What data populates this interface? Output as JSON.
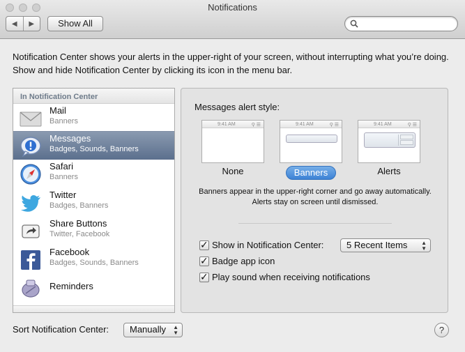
{
  "window": {
    "title": "Notifications",
    "nav_back": "◀",
    "nav_forward": "▶",
    "show_all_label": "Show All",
    "search_placeholder": ""
  },
  "description": "Notification Center shows your alerts in the upper-right of your screen, without interrupting what you’re doing. Show and hide Notification Center by clicking its icon in the menu bar.",
  "sidebar": {
    "header": "In Notification Center",
    "selected_index": 1,
    "items": [
      {
        "name": "Mail",
        "sub": "Banners",
        "icon": "mail-icon"
      },
      {
        "name": "Messages",
        "sub": "Badges, Sounds, Banners",
        "icon": "messages-icon"
      },
      {
        "name": "Safari",
        "sub": "Banners",
        "icon": "safari-icon"
      },
      {
        "name": "Twitter",
        "sub": "Badges, Banners",
        "icon": "twitter-icon"
      },
      {
        "name": "Share Buttons",
        "sub": "Twitter, Facebook",
        "icon": "share-icon"
      },
      {
        "name": "Facebook",
        "sub": "Badges, Sounds, Banners",
        "icon": "facebook-icon"
      },
      {
        "name": "Reminders",
        "sub": "",
        "icon": "reminders-icon"
      }
    ]
  },
  "panel": {
    "alert_style_label": "Messages alert style:",
    "preview_time": "9:41 AM",
    "styles": [
      "None",
      "Banners",
      "Alerts"
    ],
    "selected_style": "Banners",
    "explanation": "Banners appear in the upper-right corner and go away automatically. Alerts stay on screen until dismissed.",
    "show_in_nc_label": "Show in Notification Center:",
    "show_in_nc_checked": true,
    "recent_items_value": "5 Recent Items",
    "badge_label": "Badge app icon",
    "badge_checked": true,
    "sound_label": "Play sound when receiving notifications",
    "sound_checked": true
  },
  "footer": {
    "sort_label": "Sort Notification Center:",
    "sort_value": "Manually",
    "help_label": "?"
  },
  "colors": {
    "selection": "#5b6f8d",
    "accent": "#3d82d5"
  }
}
